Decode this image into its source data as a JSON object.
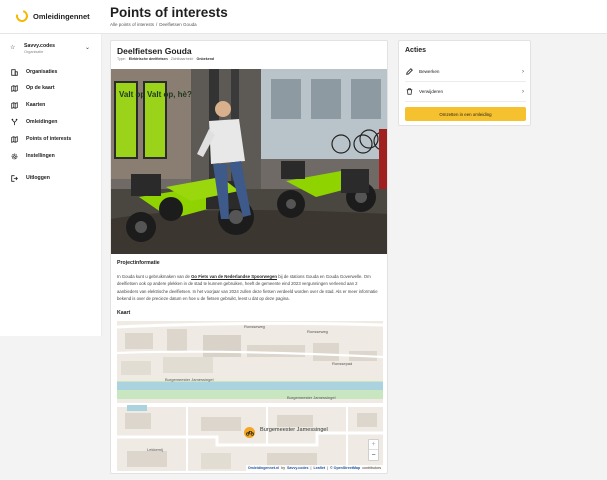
{
  "app": {
    "name": "Omleidingennet"
  },
  "header": {
    "title": "Points of interests",
    "breadcrumb": [
      "Alle points of interests",
      "/",
      "Deelfietsen Gouda"
    ]
  },
  "sidebar": {
    "org": {
      "name": "Savvy.codes",
      "sub": "Organisatie"
    },
    "items": [
      {
        "label": "Organisaties",
        "icon": "building-icon"
      },
      {
        "label": "Op de kaart",
        "icon": "map-icon"
      },
      {
        "label": "Kaarten",
        "icon": "map-folded-icon"
      },
      {
        "label": "Omleidingen",
        "icon": "detour-icon"
      },
      {
        "label": "Points of interests",
        "icon": "pin-icon"
      },
      {
        "label": "Instellingen",
        "icon": "gear-icon"
      },
      {
        "label": "Uitloggen",
        "icon": "logout-icon"
      }
    ]
  },
  "poi": {
    "title": "Deelfietsen Gouda",
    "meta": {
      "type_label": "Type:",
      "type_value": "Elektrische deelfietsen",
      "visibility_label": "Zichtbaarheid:",
      "visibility_value": "Onbekend"
    },
    "photo": {
      "sign_text_1": "Valt op, hè?",
      "sign_text_2": "Valt op, hè?"
    },
    "project_heading": "Projectinformatie",
    "paragraph": {
      "part1": "In Gouda kunt u gebruikmaken van de ",
      "link": "Go Fiets van de Nederlandse Spoorwegen",
      "part2": " bij de stations Gouda en Gouda Goverwelle. Om deelfietsen ook op andere plekken in de stad te kunnen gebruiken, heeft de gemeente eind 2023 vergunningen verleend aan 2 aanbieders van elektrische deelfietsen. In het voorjaar van 2024 zullen deze fietsen verdeeld worden over de stad. Als er meer informatie bekend is over de precieze datum en hoe u de fietsen gebruikt, leest u dat op deze pagina."
    },
    "map_heading": "Kaart",
    "map": {
      "marker_label": "Burgemeester Jamessingel",
      "streets": [
        "Ronsseweg",
        "Ronsseweg",
        "Burgemeester Jamessingel",
        "Burgemeester Jamessingel",
        "Ronssepad",
        "Lekkemij"
      ],
      "zoom_in": "+",
      "zoom_out": "−",
      "attribution": {
        "a": "Omleidingennet.nl",
        "by": "by",
        "b": "Savvy.codes",
        "sep1": "|",
        "c": "Leaflet",
        "sep2": "|",
        "d": "© OpenStreetMap",
        "e": "contributors"
      }
    }
  },
  "actions": {
    "title": "Acties",
    "items": [
      {
        "label": "Bewerken",
        "icon": "pencil-icon"
      },
      {
        "label": "Verwijderen",
        "icon": "trash-icon"
      }
    ],
    "cta": "Omzetten in een omleiding"
  },
  "colors": {
    "accent": "#f5c12e",
    "marker": "#f5a623",
    "bike_green": "#8fd400"
  }
}
